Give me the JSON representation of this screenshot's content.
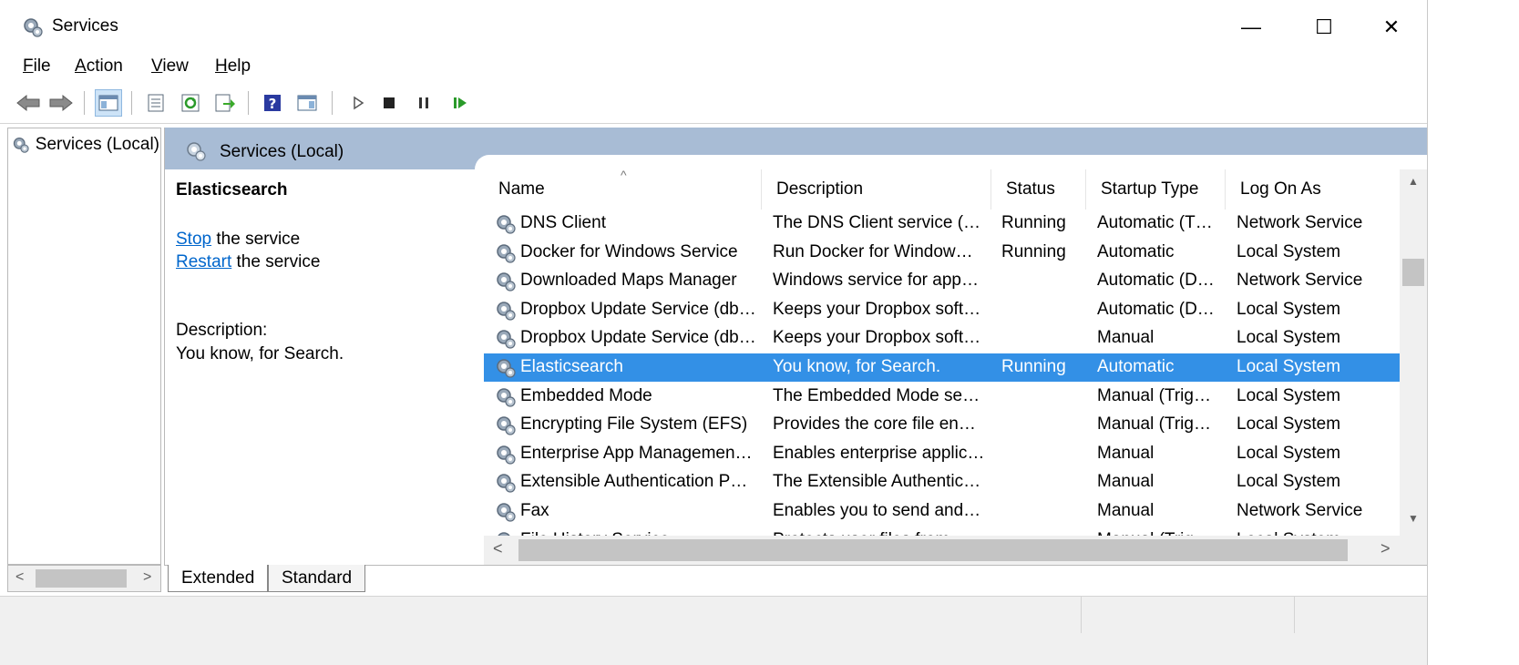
{
  "window": {
    "title": "Services"
  },
  "window_controls": {
    "minimize": "—",
    "maximize": "☐",
    "close": "✕"
  },
  "menu": [
    {
      "key": "F",
      "rest": "ile"
    },
    {
      "key": "A",
      "rest": "ction"
    },
    {
      "key": "V",
      "rest": "iew"
    },
    {
      "key": "H",
      "rest": "elp"
    }
  ],
  "toolbar_icons": [
    "back-arrow-icon",
    "forward-arrow-icon",
    "show-hide-console-tree-icon",
    "properties-icon",
    "refresh-icon",
    "export-list-icon",
    "help-icon",
    "show-hide-action-pane-icon",
    "start-service-icon",
    "stop-service-icon",
    "pause-service-icon",
    "resume-service-icon"
  ],
  "tree": {
    "item": "Services (Local)"
  },
  "pane": {
    "title": "Services (Local)"
  },
  "detail": {
    "name": "Elasticsearch",
    "stop_link": "Stop",
    "stop_rest": " the service",
    "restart_link": "Restart",
    "restart_rest": " the service",
    "description_label": "Description:",
    "description": "You know, for Search."
  },
  "columns": {
    "name": "Name",
    "description": "Description",
    "status": "Status",
    "startup": "Startup Type",
    "logon": "Log On As",
    "sort_indicator": "^"
  },
  "rows": [
    {
      "name": "DNS Client",
      "description": "The DNS Client service (…",
      "status": "Running",
      "startup": "Automatic (T…",
      "logon": "Network Service"
    },
    {
      "name": "Docker for Windows Service",
      "description": "Run Docker for Window…",
      "status": "Running",
      "startup": "Automatic",
      "logon": "Local System"
    },
    {
      "name": "Downloaded Maps Manager",
      "description": "Windows service for app…",
      "status": "",
      "startup": "Automatic (D…",
      "logon": "Network Service"
    },
    {
      "name": "Dropbox Update Service (db…",
      "description": "Keeps your Dropbox soft…",
      "status": "",
      "startup": "Automatic (D…",
      "logon": "Local System"
    },
    {
      "name": "Dropbox Update Service (db…",
      "description": "Keeps your Dropbox soft…",
      "status": "",
      "startup": "Manual",
      "logon": "Local System"
    },
    {
      "name": "Elasticsearch",
      "description": "You know, for Search.",
      "status": "Running",
      "startup": "Automatic",
      "logon": "Local System"
    },
    {
      "name": "Embedded Mode",
      "description": "The Embedded Mode se…",
      "status": "",
      "startup": "Manual (Trig…",
      "logon": "Local System"
    },
    {
      "name": "Encrypting File System (EFS)",
      "description": "Provides the core file en…",
      "status": "",
      "startup": "Manual (Trig…",
      "logon": "Local System"
    },
    {
      "name": "Enterprise App Managemen…",
      "description": "Enables enterprise applic…",
      "status": "",
      "startup": "Manual",
      "logon": "Local System"
    },
    {
      "name": "Extensible Authentication P…",
      "description": "The Extensible Authentic…",
      "status": "",
      "startup": "Manual",
      "logon": "Local System"
    },
    {
      "name": "Fax",
      "description": "Enables you to send and…",
      "status": "",
      "startup": "Manual",
      "logon": "Network Service"
    },
    {
      "name": "File History Service",
      "description": "Protects user files from…",
      "status": "",
      "startup": "Manual (Trig…",
      "logon": "Local System"
    }
  ],
  "selected_row": "Elasticsearch",
  "scroll_arrows": {
    "up": "▲",
    "down": "▼",
    "left": "<",
    "right": ">"
  },
  "tabs": {
    "extended": "Extended",
    "standard": "Standard"
  },
  "colors": {
    "selection": "#3390e6",
    "header_band": "#a8bcd5",
    "link": "#0066cc"
  }
}
